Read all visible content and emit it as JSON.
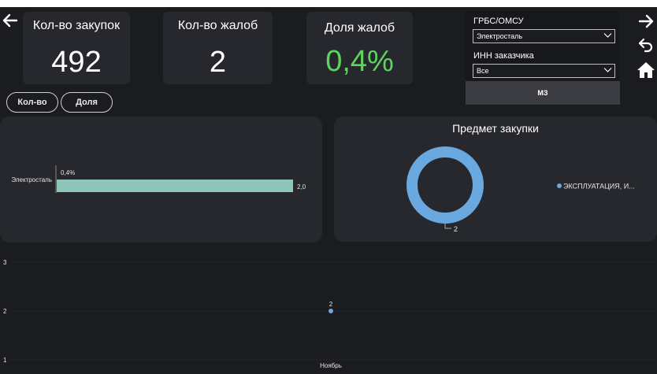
{
  "kpis": {
    "purchases": {
      "label": "Кол-во закупок",
      "value": "492"
    },
    "complaints": {
      "label": "Кол-во жалоб",
      "value": "2"
    },
    "share": {
      "label": "Доля жалоб",
      "value": "0,4%"
    }
  },
  "toggles": {
    "count": "Кол-во",
    "share": "Доля"
  },
  "filters": {
    "grbs_label": "ГРБС/ОМСУ",
    "grbs_value": "Электросталь",
    "inn_label": "ИНН заказчика",
    "inn_value": "Все",
    "mz_button": "МЗ"
  },
  "bar_chart": {
    "category": "Электросталь",
    "share_label": "0,4%",
    "value_label": "2,0",
    "chart_data": {
      "type": "bar",
      "categories": [
        "Электросталь"
      ],
      "values": [
        2.0
      ]
    }
  },
  "donut_chart": {
    "title": "Предмет закупки",
    "legend_label": "ЭКСПЛУАТАЦИЯ, И...",
    "value_label": "2",
    "color": "#6aa8e0",
    "chart_data": {
      "type": "pie",
      "categories": [
        "ЭКСПЛУАТАЦИЯ, И..."
      ],
      "values": [
        2
      ]
    }
  },
  "line_chart": {
    "y_ticks": [
      "3",
      "2",
      "1"
    ],
    "x_label": "Ноябрь",
    "point_label": "2",
    "chart_data": {
      "type": "scatter",
      "x": [
        "Ноябрь"
      ],
      "y": [
        2
      ],
      "ylim": [
        1,
        3
      ]
    }
  },
  "colors": {
    "background": "#1b1c20",
    "card": "#26282e",
    "accent_green": "#5ed45e",
    "bar": "#8fc4b8",
    "series_blue": "#6aa8e0"
  },
  "icons": {
    "back": "arrow-left-icon",
    "forward": "arrow-right-icon",
    "undo": "undo-icon",
    "home": "home-icon"
  }
}
